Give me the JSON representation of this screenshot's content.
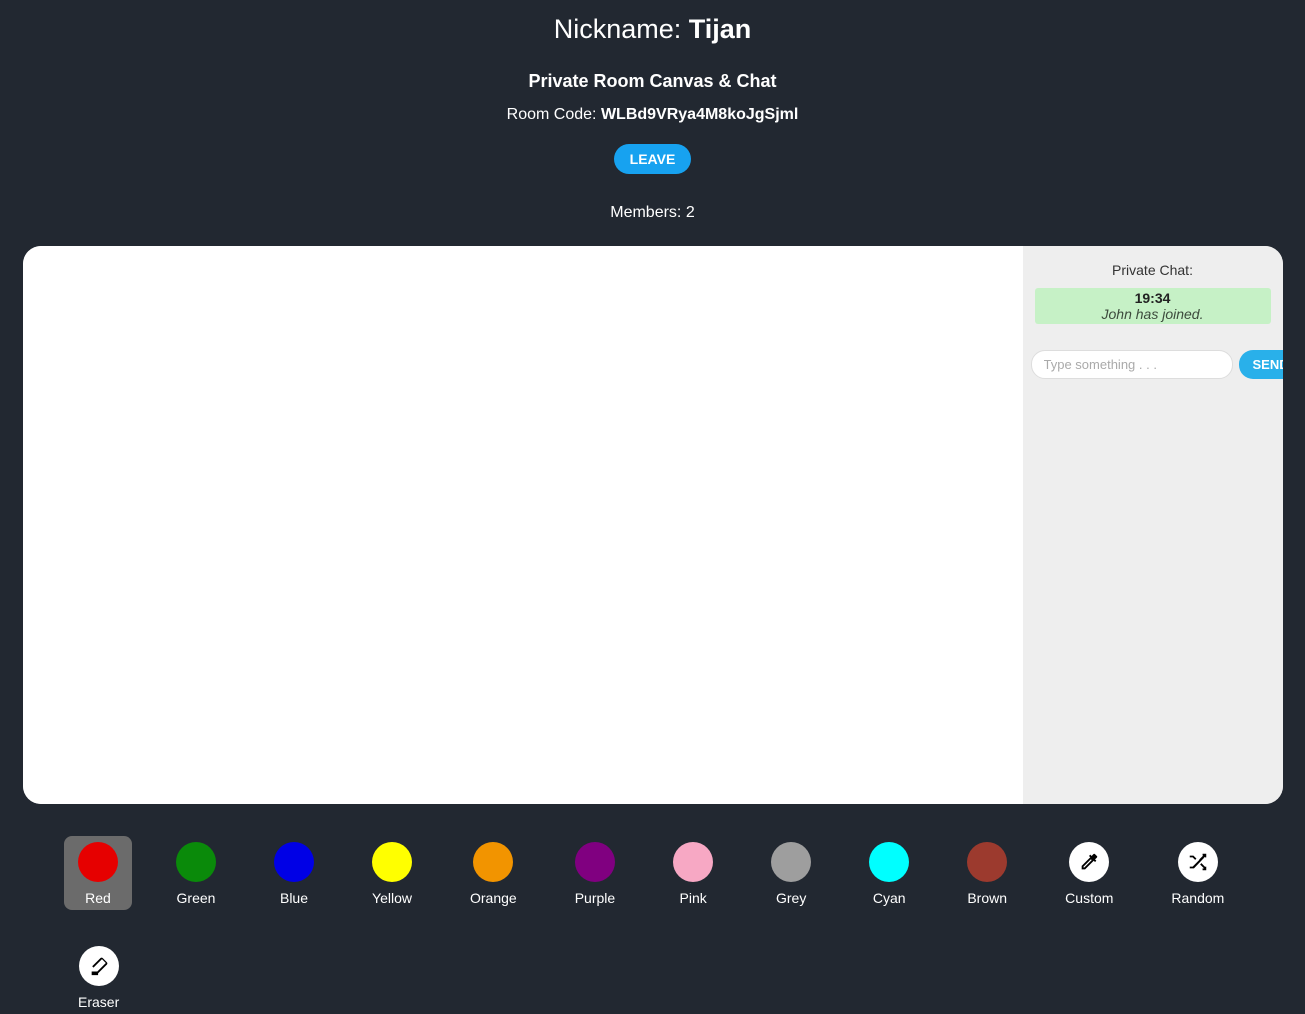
{
  "header": {
    "nickname_label": "Nickname: ",
    "nickname": "Tijan",
    "room_title": "Private Room Canvas & Chat",
    "room_code_label": "Room Code: ",
    "room_code": "WLBd9VRya4M8koJgSjml",
    "leave_label": "LEAVE",
    "members_label": "Members: ",
    "members_count": "2"
  },
  "chat": {
    "title": "Private Chat:",
    "messages": [
      {
        "time": "19:34",
        "text": "John has joined."
      }
    ],
    "input_placeholder": "Type something . . .",
    "send_label": "SEND"
  },
  "palette": {
    "items": [
      {
        "name": "Red",
        "color": "#e60000",
        "selected": true
      },
      {
        "name": "Green",
        "color": "#0a8a0a",
        "selected": false
      },
      {
        "name": "Blue",
        "color": "#0000e6",
        "selected": false
      },
      {
        "name": "Yellow",
        "color": "#ffff00",
        "selected": false
      },
      {
        "name": "Orange",
        "color": "#f29400",
        "selected": false
      },
      {
        "name": "Purple",
        "color": "#800080",
        "selected": false
      },
      {
        "name": "Pink",
        "color": "#f7a8c4",
        "selected": false
      },
      {
        "name": "Grey",
        "color": "#9e9e9e",
        "selected": false
      },
      {
        "name": "Cyan",
        "color": "#00ffff",
        "selected": false
      },
      {
        "name": "Brown",
        "color": "#9c3a2e",
        "selected": false
      }
    ],
    "tools": [
      {
        "name": "Custom",
        "icon": "eyedropper"
      },
      {
        "name": "Random",
        "icon": "shuffle"
      },
      {
        "name": "Eraser",
        "icon": "eraser"
      }
    ]
  }
}
